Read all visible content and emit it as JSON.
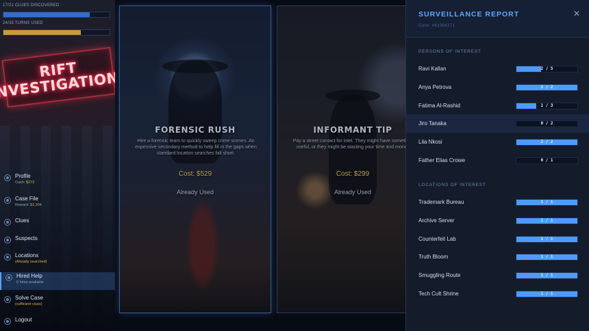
{
  "sidebar": {
    "clues_progress": {
      "label": "17/21 CLUES DISCOVERED",
      "fraction": 0.81,
      "color": "#2f6fd0"
    },
    "turns_progress": {
      "label": "24/33 TURNS USED",
      "fraction": 0.73,
      "color": "#c89a3a"
    },
    "sign": {
      "line1": "RIFT",
      "line2": "INVESTIGATIONS"
    },
    "nav": [
      {
        "label": "Profile",
        "sub_prefix": "Cash: ",
        "sub_value": "$273",
        "sub_style": "val",
        "icon": "profile-icon"
      },
      {
        "label": "Case File",
        "sub_prefix": "Reward: ",
        "sub_value": "$2,304",
        "sub_style": "green",
        "icon": "case-file-icon"
      },
      {
        "label": "Clues",
        "sub_prefix": "",
        "sub_value": "",
        "sub_style": "",
        "icon": "clues-icon"
      },
      {
        "label": "Suspects",
        "sub_prefix": "",
        "sub_value": "",
        "sub_style": "",
        "icon": "suspects-icon"
      },
      {
        "label": "Locations",
        "sub_prefix": "",
        "sub_value": "(Already searched)",
        "sub_style": "val",
        "icon": "locations-icon"
      },
      {
        "label": "Hired Help",
        "sub_prefix": "",
        "sub_value": "0 hires available",
        "sub_style": "",
        "icon": "hired-help-icon",
        "active": true
      },
      {
        "label": "Solve Case",
        "sub_prefix": "",
        "sub_value": "(sufficient clues)",
        "sub_style": "val",
        "icon": "solve-case-icon"
      },
      {
        "label": "Logout",
        "sub_prefix": "",
        "sub_value": "",
        "sub_style": "",
        "icon": "logout-icon"
      }
    ]
  },
  "cards": [
    {
      "title": "FORENSIC RUSH",
      "description": "Hire a forensic team to quickly sweep crime scenes. An expensive secondary method to help fill in the gaps when standard location searches fall short.",
      "cost": "Cost: $529",
      "status": "Already Used"
    },
    {
      "title": "INFORMANT TIP",
      "description": "Pay a street contact for intel. They might have something useful, or they might be wasting your time and money.",
      "cost": "Cost: $299",
      "status": "Already Used"
    }
  ],
  "report": {
    "title": "SURVEILLANCE REPORT",
    "case_id": "Case: #61984271",
    "close_label": "✕",
    "persons_title": "PERSONS OF INTEREST",
    "persons": [
      {
        "name": "Ravi Kallan",
        "value": "2 / 5",
        "fraction": 0.4
      },
      {
        "name": "Anya Petrova",
        "value": "2 / 2",
        "fraction": 1.0
      },
      {
        "name": "Fatima Al-Rashid",
        "value": "1 / 3",
        "fraction": 0.33
      },
      {
        "name": "Jiro Tanaka",
        "value": "0 / 2",
        "fraction": 0.0,
        "highlight": true
      },
      {
        "name": "Lila Nkosi",
        "value": "2 / 2",
        "fraction": 1.0
      },
      {
        "name": "Father Elias Crowe",
        "value": "0 / 1",
        "fraction": 0.0
      }
    ],
    "locations_title": "LOCATIONS OF INTEREST",
    "locations": [
      {
        "name": "Trademark Bureau",
        "value": "1 / 1",
        "fraction": 1.0
      },
      {
        "name": "Archive Server",
        "value": "1 / 1",
        "fraction": 1.0
      },
      {
        "name": "Counterfeit Lab",
        "value": "1 / 1",
        "fraction": 1.0
      },
      {
        "name": "Truth Bloom",
        "value": "1 / 1",
        "fraction": 1.0
      },
      {
        "name": "Smuggling Route",
        "value": "1 / 1",
        "fraction": 1.0
      },
      {
        "name": "Tech Cult Shrine",
        "value": "1 / 1",
        "fraction": 1.0
      }
    ]
  }
}
